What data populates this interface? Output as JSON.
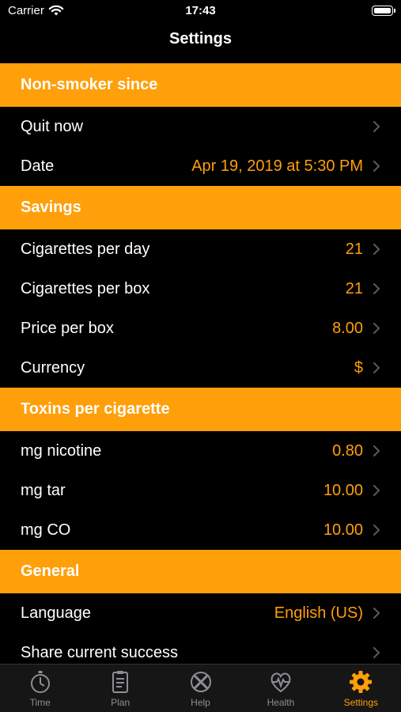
{
  "status": {
    "carrier": "Carrier",
    "time": "17:43"
  },
  "nav": {
    "title": "Settings"
  },
  "sections": {
    "nonsmoker": {
      "header": "Non-smoker since",
      "rows": [
        {
          "label": "Quit now",
          "value": ""
        },
        {
          "label": "Date",
          "value": "Apr 19, 2019 at 5:30 PM"
        }
      ]
    },
    "savings": {
      "header": "Savings",
      "rows": [
        {
          "label": "Cigarettes per day",
          "value": "21"
        },
        {
          "label": "Cigarettes per box",
          "value": "21"
        },
        {
          "label": "Price per box",
          "value": "8.00"
        },
        {
          "label": "Currency",
          "value": "$"
        }
      ]
    },
    "toxins": {
      "header": "Toxins per cigarette",
      "rows": [
        {
          "label": "mg nicotine",
          "value": "0.80"
        },
        {
          "label": "mg tar",
          "value": "10.00"
        },
        {
          "label": "mg CO",
          "value": "10.00"
        }
      ]
    },
    "general": {
      "header": "General",
      "rows": [
        {
          "label": "Language",
          "value": "English (US)"
        },
        {
          "label": "Share current success",
          "value": ""
        }
      ]
    }
  },
  "tabs": [
    {
      "label": "Time",
      "icon": "stopwatch-icon"
    },
    {
      "label": "Plan",
      "icon": "clipboard-icon"
    },
    {
      "label": "Help",
      "icon": "help-icon"
    },
    {
      "label": "Health",
      "icon": "heart-pulse-icon"
    },
    {
      "label": "Settings",
      "icon": "gear-icon",
      "active": true
    }
  ],
  "colors": {
    "accent": "#ff9f0a",
    "background": "#000000",
    "tab_bar": "#161616",
    "inactive": "#8e8e93"
  }
}
